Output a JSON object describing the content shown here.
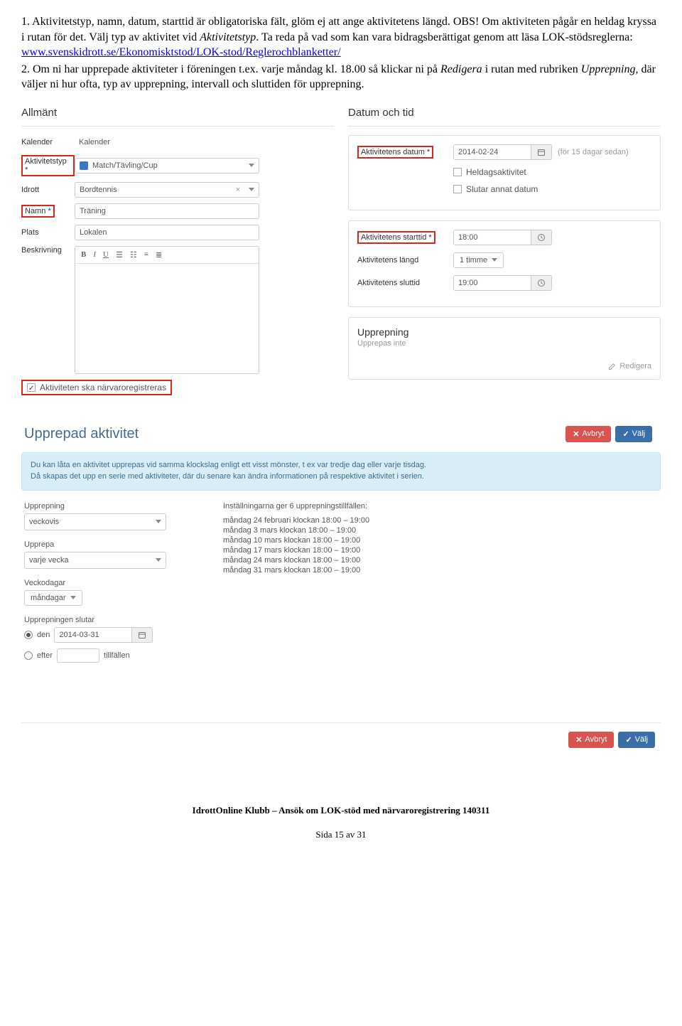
{
  "intro": {
    "p1a": "1. Aktivitetstyp, namn, datum, starttid är obligatoriska fält, glöm ej att ange aktivitetens längd. OBS! Om aktiviteten pågår en heldag kryssa i rutan för det. Välj typ av aktivitet vid ",
    "p1b": "Aktivitetstyp",
    "p1c": ". Ta reda på vad som kan vara bidragsberättigat genom att läsa LOK-stödsreglerna: ",
    "link": "www.svenskidrott.se/Ekonomisktstod/LOK-stod/Reglerochblanketter/",
    "p2a": "2. Om ni har upprepade aktiviteter i föreningen t.ex. varje måndag kl. 18.00 så klickar ni på ",
    "p2b": "Redigera",
    "p2c": " i rutan med rubriken ",
    "p2d": "Upprepning",
    "p2e": ", där väljer ni hur ofta, typ av upprepning, intervall och sluttiden för upprepning."
  },
  "panel1": {
    "left": {
      "title": "Allmänt",
      "rows": {
        "kalender_label": "Kalender",
        "kalender_value": "Kalender",
        "aktivitetstyp_label": "Aktivitetstyp *",
        "aktivitetstyp_value": "Match/Tävling/Cup",
        "idrott_label": "Idrott",
        "idrott_value": "Bordtennis",
        "namn_label": "Namn *",
        "namn_value": "Träning",
        "plats_label": "Plats",
        "plats_value": "Lokalen",
        "beskrivning_label": "Beskrivning"
      },
      "attendance": "Aktiviteten ska närvaroregistreras"
    },
    "right": {
      "title": "Datum och tid",
      "date_label": "Aktivitetens datum *",
      "date_value": "2014-02-24",
      "date_hint": "(för 15 dagar sedan)",
      "heldag": "Heldagsaktivitet",
      "slutar": "Slutar annat datum",
      "start_label": "Aktivitetens starttid *",
      "start_value": "18:00",
      "length_label": "Aktivitetens längd",
      "length_value": "1 timme",
      "end_label": "Aktivitetens sluttid",
      "end_value": "19:00",
      "uppr_title": "Upprepning",
      "uppr_sub": "Upprepas inte",
      "edit": "Redigera"
    }
  },
  "panel2": {
    "title": "Upprepad aktivitet",
    "btn_cancel": "Avbryt",
    "btn_ok": "Välj",
    "info1": "Du kan låta en aktivitet upprepas vid samma klockslag enligt ett visst mönster, t ex var tredje dag eller varje tisdag.",
    "info2": "Då skapas det upp en serie med aktiviteter, där du senare kan ändra informationen på respektive aktivitet i serien.",
    "left": {
      "l1": "Upprepning",
      "v1": "veckovis",
      "l2": "Upprepa",
      "v2": "varje vecka",
      "l3": "Veckodagar",
      "v3": "måndagar",
      "l4": "Upprepningen slutar",
      "r1": "den",
      "r1v": "2014-03-31",
      "r2": "efter",
      "r2s": "tillfällen"
    },
    "right": {
      "head": "Inställningarna ger 6 upprepningstillfällen:",
      "lines": [
        "måndag 24 februari klockan 18:00 – 19:00",
        "måndag 3 mars klockan 18:00 – 19:00",
        "måndag 10 mars klockan 18:00 – 19:00",
        "måndag 17 mars klockan 18:00 – 19:00",
        "måndag 24 mars klockan 18:00 – 19:00",
        "måndag 31 mars klockan 18:00 – 19:00"
      ]
    }
  },
  "footer": {
    "line1": "IdrottOnline Klubb – Ansök om LOK-stöd med närvaroregistrering 140311",
    "line2": "Sida 15 av 31"
  }
}
